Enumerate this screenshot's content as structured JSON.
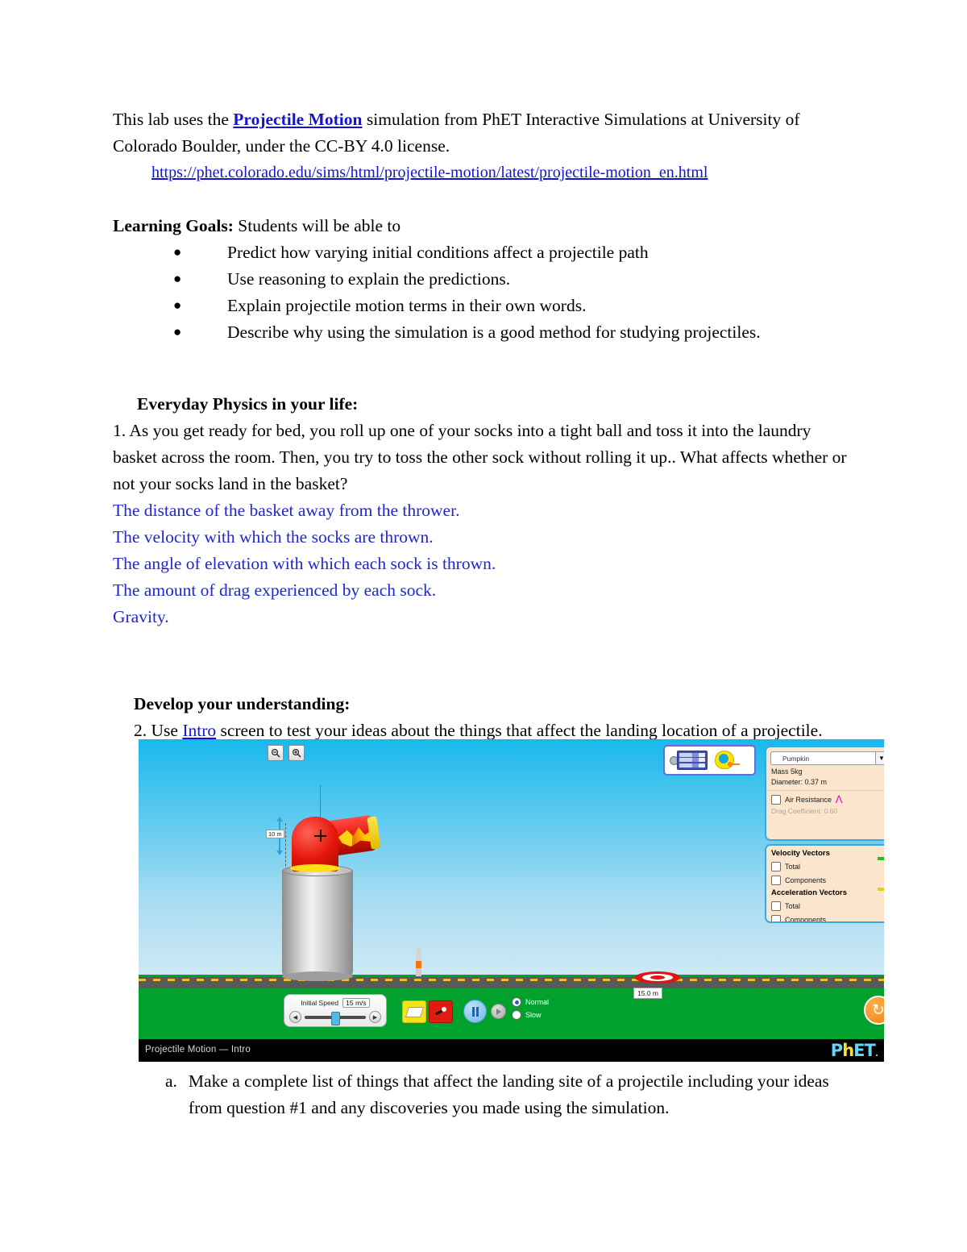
{
  "intro": {
    "line1_before": "This lab uses the ",
    "line1_link": "Projectile Motion",
    "line1_after": " simulation from PhET Interactive Simulations at University of Colorado Boulder, under the CC-BY 4.0 license.",
    "url": "https://phet.colorado.edu/sims/html/projectile-motion/latest/projectile-motion_en.html"
  },
  "learning_goals": {
    "heading_bold": "Learning Goals:",
    "heading_rest": " Students will be able to",
    "items": [
      "Predict how varying initial conditions affect a projectile path",
      "Use reasoning to explain the predictions.",
      "Explain projectile motion terms in their own words.",
      "Describe why using the simulation is a good method for studying projectiles."
    ]
  },
  "everyday": {
    "heading": "Everyday Physics in your life:",
    "question": "1. As you get ready for bed, you roll up one of your socks into a tight ball and toss it into the laundry basket across the room. Then, you try to toss the other sock without rolling it up.. What affects whether or not your socks land in the basket?",
    "answers": [
      "The distance of the basket away from the thrower.",
      "The velocity with which the socks are thrown.",
      "The angle of elevation with which each sock is thrown.",
      "The amount of drag experienced by each sock.",
      "Gravity."
    ]
  },
  "develop": {
    "heading": "Develop your understanding:",
    "q2_before": "2. Use ",
    "q2_link": "Intro",
    "q2_after": " screen to test your ideas about the things that affect the landing location of a projectile.",
    "sub_a_marker": "a.",
    "sub_a_text": "Make a complete list of things that affect the landing site of a projectile including your ideas from question #1 and any discoveries you made using the simulation."
  },
  "simulation": {
    "title": "Projectile Motion — Intro",
    "logo": "PhET",
    "logo_h": "h",
    "zoom_out_icon": "zoom-out-icon",
    "zoom_in_icon": "zoom-in-icon",
    "toolbox": {
      "data_probe_icon": "data-probe-icon",
      "measuring_tape_icon": "measuring-tape-icon"
    },
    "projectile_panel": {
      "selected": "Pumpkin",
      "caret": "▼",
      "mass": "Mass 5kg",
      "diameter": "Diameter: 0.37 m",
      "air_resistance": "Air Resistance",
      "drag_coefficient": "Drag Coefficient: 0.60"
    },
    "vectors_panel": {
      "velocity_heading": "Velocity Vectors",
      "velocity_total": "Total",
      "velocity_components": "Components",
      "acceleration_heading": "Acceleration Vectors",
      "acceleration_total": "Total",
      "acceleration_components": "Components",
      "velocity_color": "#16c21a",
      "acceleration_color": "#e3d014"
    },
    "cannon": {
      "height_label": "10 m"
    },
    "target": {
      "distance_label": "15.0 m"
    },
    "controls": {
      "initial_speed_label": "Initial Speed",
      "initial_speed_value": "15 m/s",
      "eraser_icon": "eraser-icon",
      "fire_icon": "fire-cannon-icon",
      "play_pause_icon": "pause-icon",
      "step_icon": "step-forward-icon",
      "normal_label": "Normal",
      "slow_label": "Slow",
      "reset_icon": "reset-all-icon",
      "slider_left_icon": "◀",
      "slider_right_icon": "▶"
    }
  }
}
